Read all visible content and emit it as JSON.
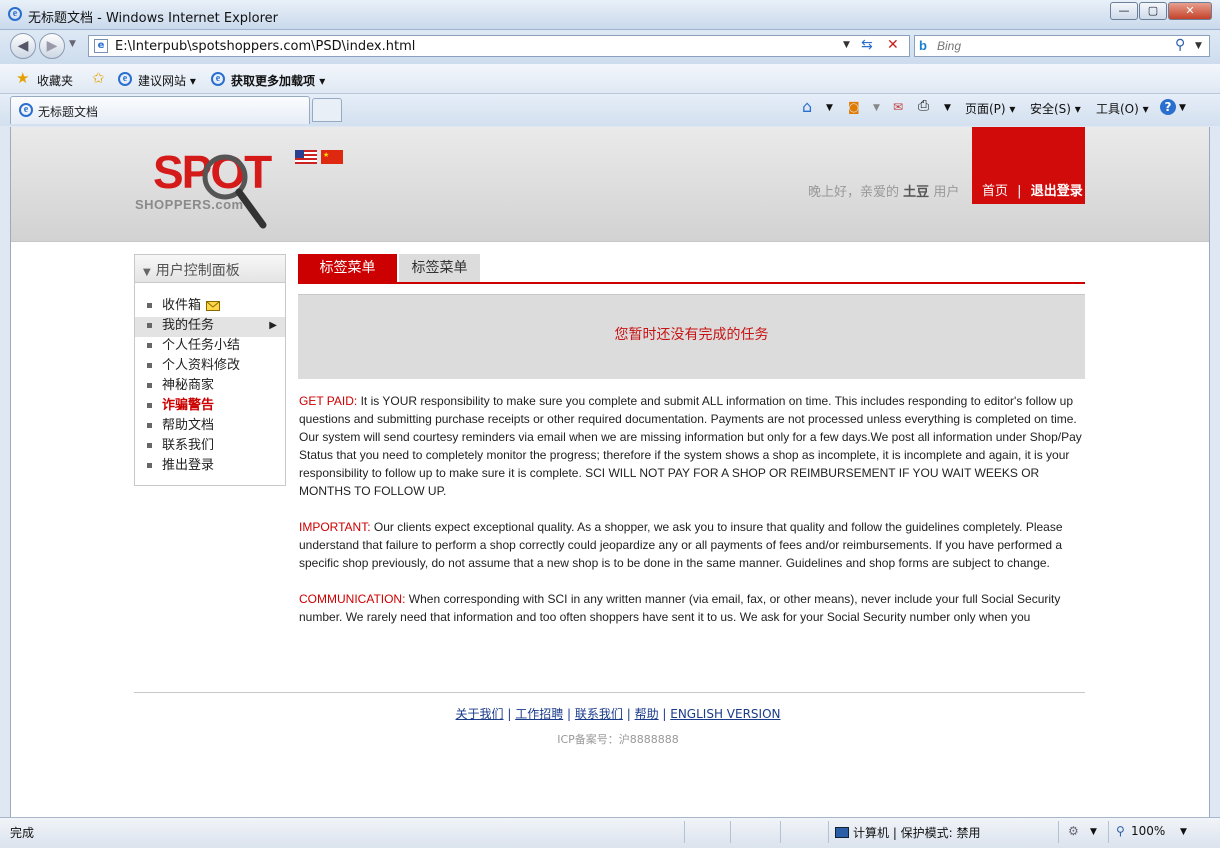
{
  "window": {
    "title": "无标题文档 - Windows Internet Explorer"
  },
  "address": {
    "url": "E:\\Interpub\\spotshoppers.com\\PSD\\index.html"
  },
  "search": {
    "placeholder": "Bing"
  },
  "favorites_bar": {
    "favorites": "收藏夹",
    "suggested": "建议网站",
    "addons": "获取更多加载项"
  },
  "tab": {
    "title": "无标题文档"
  },
  "command_bar": {
    "page": "页面(P)",
    "safety": "安全(S)",
    "tools": "工具(O)"
  },
  "site": {
    "logo_spot": "SPOT",
    "logo_shoppers": "SHOPPERS.com",
    "greeting": {
      "prefix": "晚上好，亲爱的",
      "username": "土豆",
      "suffix": "用户"
    },
    "nav": {
      "home": "首页",
      "separator": "|",
      "logout": "退出登录"
    }
  },
  "sidebar": {
    "title": "用户控制面板",
    "items": [
      {
        "label": "收件箱"
      },
      {
        "label": "我的任务"
      },
      {
        "label": "个人任务小结"
      },
      {
        "label": "个人资料修改"
      },
      {
        "label": "神秘商家"
      },
      {
        "label": "诈骗警告"
      },
      {
        "label": "帮助文档"
      },
      {
        "label": "联系我们"
      },
      {
        "label": "推出登录"
      }
    ]
  },
  "content": {
    "tabs": [
      {
        "label": "标签菜单"
      },
      {
        "label": "标签菜单"
      }
    ],
    "notice": "您暂时还没有完成的任务",
    "paragraphs": [
      {
        "label": "GET PAID:",
        "text": " It is YOUR responsibility to make sure you complete and submit ALL information on time. This includes responding to editor's follow up questions and submitting purchase receipts or other required documentation. Payments are not processed unless everything is completed on time. Our system will send courtesy reminders via email when we are missing information but only for a few days.We post all information under Shop/Pay Status that you need to completely monitor the progress; therefore if the system shows a shop as incomplete, it is incomplete and again, it is your responsibility to follow up to make sure it is complete. SCI WILL NOT PAY FOR A SHOP OR REIMBURSEMENT IF YOU WAIT WEEKS OR MONTHS TO FOLLOW UP."
      },
      {
        "label": "IMPORTANT:",
        "text": " Our clients expect exceptional quality. As a shopper, we ask you to insure that quality and follow the guidelines completely. Please understand that failure to perform a shop correctly could jeopardize any or all payments of fees and/or reimbursements. If you have performed a specific shop previously, do not assume that a new shop is to be done in the same manner. Guidelines and shop forms are subject to change."
      },
      {
        "label": "COMMUNICATION:",
        "text": " When corresponding with SCI in any written manner (via email, fax, or other means), never include your full Social Security number. We rarely need that information and too often shoppers have sent it to us. We ask for your Social Security number only when you"
      }
    ]
  },
  "footer": {
    "links": [
      {
        "label": "关于我们"
      },
      {
        "label": "工作招聘"
      },
      {
        "label": "联系我们"
      },
      {
        "label": "帮助"
      },
      {
        "label": "ENGLISH VERSION"
      }
    ],
    "icp": "ICP备案号：沪8888888"
  },
  "statusbar": {
    "status": "完成",
    "zone": "计算机 | 保护模式: 禁用",
    "zoom": "100%"
  }
}
